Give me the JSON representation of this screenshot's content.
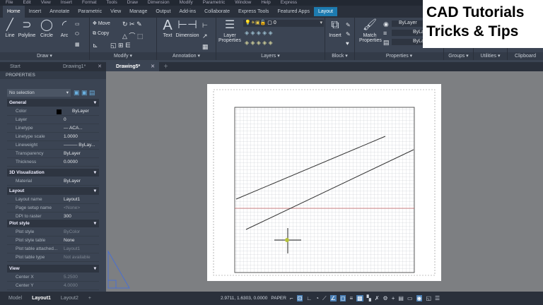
{
  "menu": [
    "File",
    "Edit",
    "View",
    "Insert",
    "Format",
    "Tools",
    "Draw",
    "Dimension",
    "Modify",
    "Parametric",
    "Window",
    "Help",
    "Express"
  ],
  "ribbon_tabs": [
    "Home",
    "Insert",
    "Annotate",
    "Parametric",
    "View",
    "Manage",
    "Output",
    "Add-ins",
    "Collaborate",
    "Express Tools",
    "Featured Apps",
    "Layout"
  ],
  "panels": {
    "draw": {
      "title": "Draw ▾",
      "tools": [
        "Line",
        "Polyline",
        "Circle",
        "Arc"
      ]
    },
    "modify": {
      "title": "Modify ▾",
      "move": "Move",
      "copy": "Copy"
    },
    "annotation": {
      "title": "Annotation ▾",
      "text": "Text",
      "dimension": "Dimension"
    },
    "layers": {
      "title": "Layers ▾",
      "layer_properties": "Layer Properties",
      "current_layer": "0"
    },
    "block": {
      "title": "Block ▾",
      "insert": "Insert"
    },
    "properties": {
      "title": "Properties ▾",
      "match": "Match Properties",
      "color": "ByLayer",
      "lineweight": "ByLayer",
      "linetype": "ByLayer"
    },
    "groups": {
      "title": "Groups ▾"
    },
    "utilities": {
      "title": "Utilities ▾"
    },
    "clipboard": {
      "title": "Clipboard"
    }
  },
  "brand": {
    "line1": "CAD Tutorials",
    "line2": "Tricks & Tips"
  },
  "doc_tabs": [
    {
      "label": "Start"
    },
    {
      "label": "Drawing1*"
    },
    {
      "label": "Drawing5*"
    }
  ],
  "properties_panel": {
    "title": "PROPERTIES",
    "selection": "No selection",
    "sections": {
      "general": "General",
      "viz": "3D Visualization",
      "layout": "Layout",
      "plot": "Plot style",
      "view": "View"
    },
    "general": [
      [
        "Color",
        "ByLayer"
      ],
      [
        "Layer",
        "0"
      ],
      [
        "Linetype",
        "—      ACA..."
      ],
      [
        "Linetype scale",
        "1.0000"
      ],
      [
        "Lineweight",
        "——— ByLay..."
      ],
      [
        "Transparency",
        "ByLayer"
      ],
      [
        "Thickness",
        "0.0000"
      ]
    ],
    "viz": [
      [
        "Material",
        "ByLayer"
      ]
    ],
    "layout": [
      [
        "Layout name",
        "Layout1"
      ],
      [
        "Page setup name",
        "<None>"
      ],
      [
        "DPI to raster",
        "300"
      ]
    ],
    "plot": [
      [
        "Plot style",
        "ByColor"
      ],
      [
        "Plot style table",
        "None"
      ],
      [
        "Plot table attached...",
        "Layout1"
      ],
      [
        "Plot table type",
        "Not available"
      ]
    ],
    "view": [
      [
        "Center X",
        "5.2500"
      ],
      [
        "Center Y",
        "4.0000"
      ]
    ]
  },
  "layout_tabs": [
    "Model",
    "Layout1",
    "Layout2",
    "+"
  ],
  "status": {
    "coords": "2.9711, 1.6303, 0.0000",
    "space": "PAPER"
  }
}
